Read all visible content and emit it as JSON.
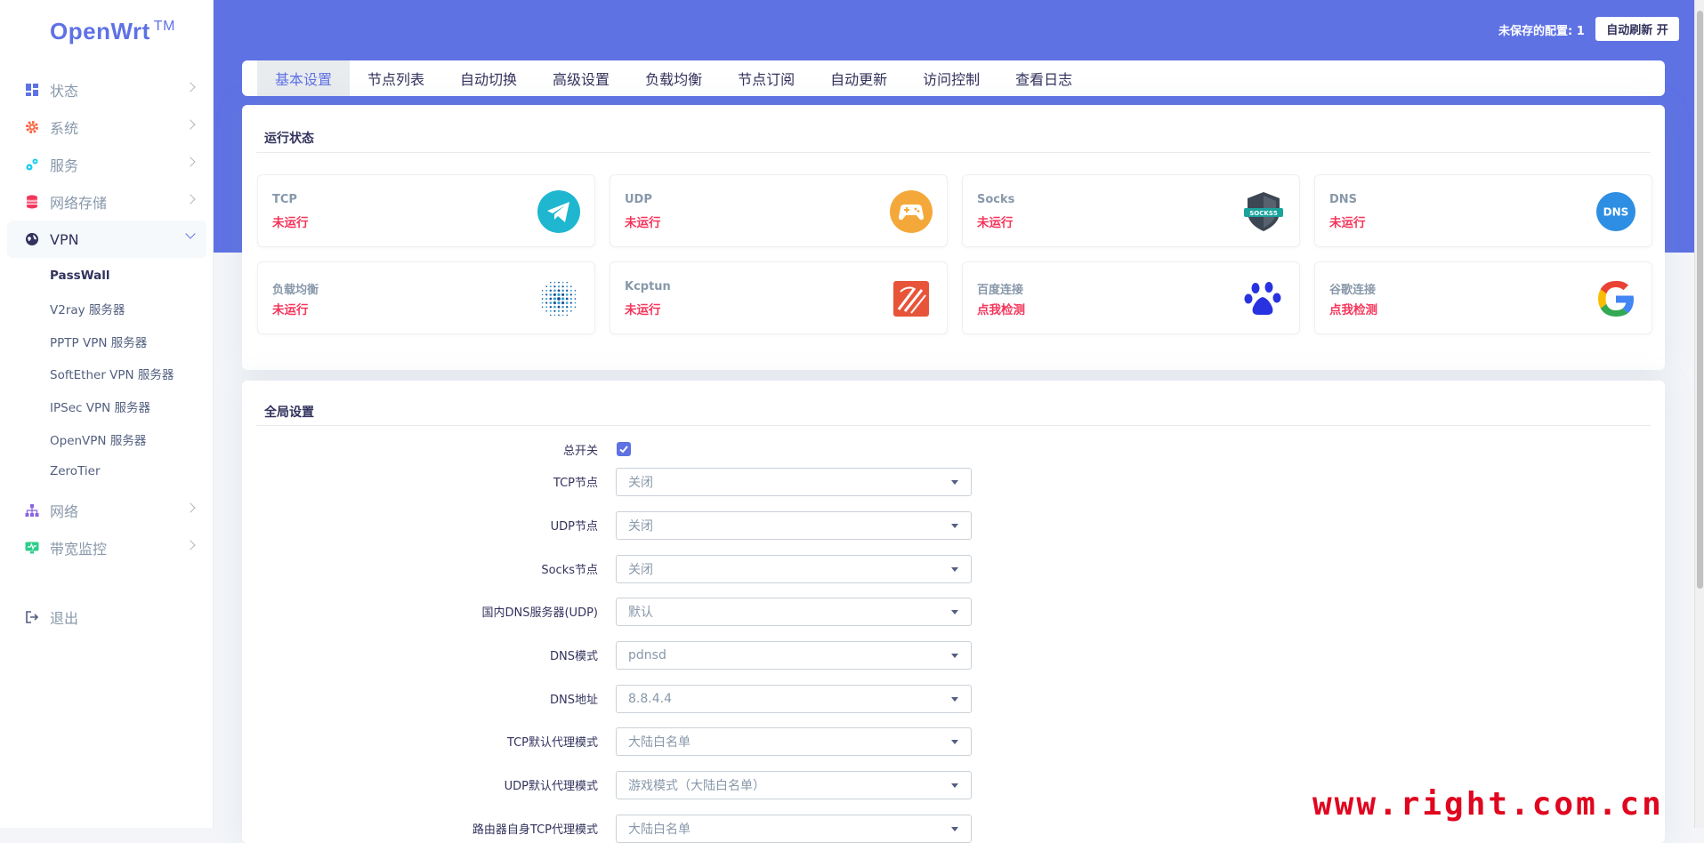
{
  "sidebar": {
    "brand": "OpenWrt",
    "brand_tm": "TM",
    "items": [
      {
        "label": "状态"
      },
      {
        "label": "系统"
      },
      {
        "label": "服务"
      },
      {
        "label": "网络存储"
      },
      {
        "label": "VPN"
      },
      {
        "label": "网络"
      },
      {
        "label": "带宽监控"
      }
    ],
    "vpn_sub": [
      "PassWall",
      "V2ray 服务器",
      "PPTP VPN 服务器",
      "SoftEther VPN 服务器",
      "IPSec VPN 服务器",
      "OpenVPN 服务器",
      "ZeroTier"
    ],
    "logout": "退出"
  },
  "header": {
    "unsaved": "未保存的配置: 1",
    "refresh": "自动刷新 开"
  },
  "tabs": [
    "基本设置",
    "节点列表",
    "自动切换",
    "高级设置",
    "负载均衡",
    "节点订阅",
    "自动更新",
    "访问控制",
    "查看日志"
  ],
  "status": {
    "title": "运行状态",
    "tiles": [
      {
        "label": "TCP",
        "status": "未运行",
        "icon": "telegram-icon"
      },
      {
        "label": "UDP",
        "status": "未运行",
        "icon": "gamepad-icon"
      },
      {
        "label": "Socks",
        "status": "未运行",
        "icon": "socks5-shield-icon",
        "badge": "SOCKS5"
      },
      {
        "label": "DNS",
        "status": "未运行",
        "icon": "dns-icon",
        "badge": "DNS"
      },
      {
        "label": "负载均衡",
        "status": "未运行",
        "icon": "dot-globe-icon"
      },
      {
        "label": "Kcptun",
        "status": "未运行",
        "icon": "kcptun-icon"
      },
      {
        "label": "百度连接",
        "status": "点我检测",
        "icon": "baidu-paw-icon"
      },
      {
        "label": "谷歌连接",
        "status": "点我检测",
        "icon": "google-icon"
      }
    ]
  },
  "global": {
    "title": "全局设置",
    "switch_label": "总开关",
    "rows": [
      {
        "label": "TCP节点",
        "value": "关闭"
      },
      {
        "label": "UDP节点",
        "value": "关闭"
      },
      {
        "label": "Socks节点",
        "value": "关闭"
      },
      {
        "label": "国内DNS服务器(UDP)",
        "value": "默认"
      },
      {
        "label": "DNS模式",
        "value": "pdnsd"
      },
      {
        "label": "DNS地址",
        "value": "8.8.4.4"
      },
      {
        "label": "TCP默认代理模式",
        "value": "大陆白名单"
      },
      {
        "label": "UDP默认代理模式",
        "value": "游戏模式（大陆白名单）"
      },
      {
        "label": "路由器自身TCP代理模式",
        "value": "大陆白名单"
      }
    ]
  },
  "watermark": "www.right.com.cn"
}
